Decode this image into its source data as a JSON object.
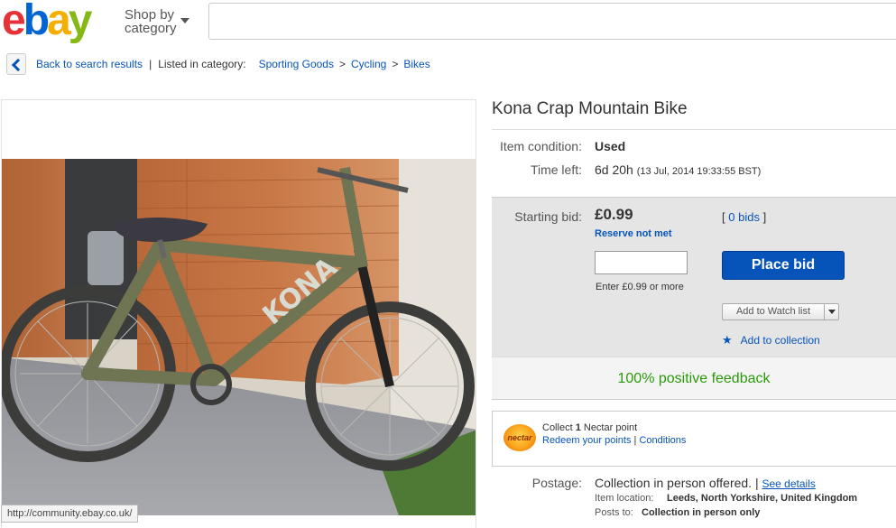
{
  "header": {
    "logo": {
      "e": "e",
      "b": "b",
      "a": "a",
      "y": "y"
    },
    "shop_by_line1": "Shop by",
    "shop_by_line2": "category",
    "search_value": ""
  },
  "breadcrumb": {
    "back_label": "Back to search results",
    "listed_label": "Listed in category:",
    "categories": [
      "Sporting Goods",
      "Cycling",
      "Bikes"
    ]
  },
  "status_bar_url": "http://community.ebay.co.uk/",
  "listing": {
    "title": "Kona Crap Mountain Bike",
    "condition_label": "Item condition:",
    "condition_value": "Used",
    "time_left_label": "Time left:",
    "time_left_value": "6d 20h",
    "time_left_date": "(13 Jul, 2014  19:33:55 BST)",
    "bid": {
      "starting_bid_label": "Starting bid:",
      "price": "£0.99",
      "reserve_status": "Reserve not met",
      "bids_prefix": "[",
      "bids_link": "0 bids",
      "bids_suffix": "]",
      "input_value": "",
      "hint": "Enter £0.99 or more",
      "place_bid_label": "Place bid",
      "watch_label": "Add to Watch list",
      "collection_label": "Add to collection"
    },
    "feedback": "100% positive feedback",
    "nectar": {
      "logo_text": "nectar",
      "collect_prefix": "Collect",
      "points": "1",
      "collect_suffix": "Nectar point",
      "redeem_link": "Redeem your points",
      "separator": "|",
      "conditions_link": "Conditions"
    },
    "postage": {
      "label": "Postage:",
      "value": "Collection in person offered.",
      "separator": "|",
      "details_link": "See details",
      "location_label": "Item location:",
      "location_value": "Leeds, North Yorkshire, United Kingdom",
      "posts_to_label": "Posts to:",
      "posts_to_value": "Collection in person only"
    }
  },
  "colors": {
    "ebay_red": "#e53238",
    "ebay_blue": "#0064d2",
    "ebay_yellow": "#f5af02",
    "ebay_green": "#86b817",
    "link_blue": "#0654ba",
    "feedback_green": "#2a9a0a",
    "bid_panel_grey": "#e5e5e5"
  }
}
